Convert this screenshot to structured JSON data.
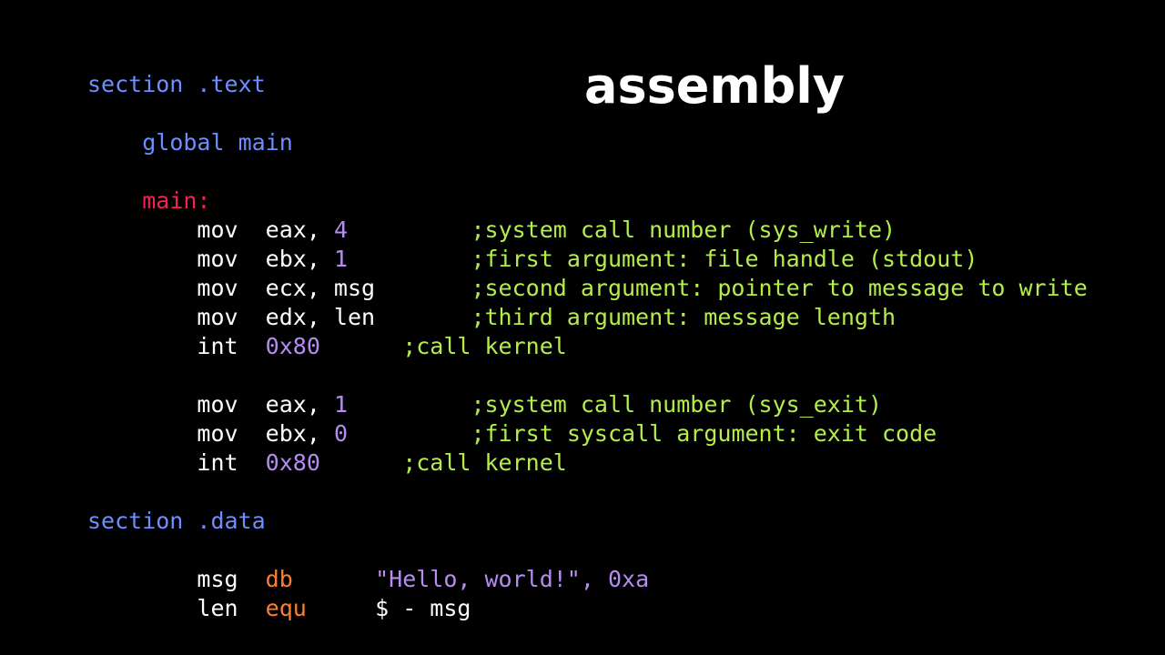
{
  "theme": {
    "background": "#000000",
    "title_color": "#ffffff",
    "directive_color": "#6e8eff",
    "label_color": "#f4224d",
    "plain_color": "#ffffff",
    "number_color": "#b68cf0",
    "string_color": "#b68cf0",
    "comment_color": "#b3ee4a",
    "pseudo_op_color": "#fd7f2e"
  },
  "title": "assembly",
  "code": {
    "language": "assembly",
    "lines": [
      {
        "id": "line-section-text",
        "tokens": [
          {
            "kind": "directive",
            "text": "section .text"
          }
        ]
      },
      {
        "id": "line-blank-1",
        "tokens": []
      },
      {
        "id": "line-global-main",
        "tokens": [
          {
            "kind": "plain",
            "text": "    "
          },
          {
            "kind": "directive",
            "text": "global main"
          }
        ]
      },
      {
        "id": "line-blank-2",
        "tokens": []
      },
      {
        "id": "line-label-main",
        "tokens": [
          {
            "kind": "plain",
            "text": "    "
          },
          {
            "kind": "label",
            "text": "main:"
          }
        ]
      },
      {
        "id": "line-mov-eax-4",
        "tokens": [
          {
            "kind": "plain",
            "text": "        mov  eax, "
          },
          {
            "kind": "num",
            "text": "4"
          },
          {
            "kind": "plain",
            "text": "         "
          },
          {
            "kind": "comment",
            "text": ";system call number (sys_write)"
          }
        ]
      },
      {
        "id": "line-mov-ebx-1",
        "tokens": [
          {
            "kind": "plain",
            "text": "        mov  ebx, "
          },
          {
            "kind": "num",
            "text": "1"
          },
          {
            "kind": "plain",
            "text": "         "
          },
          {
            "kind": "comment",
            "text": ";first argument: file handle (stdout)"
          }
        ]
      },
      {
        "id": "line-mov-ecx-msg",
        "tokens": [
          {
            "kind": "plain",
            "text": "        mov  ecx, msg       "
          },
          {
            "kind": "comment",
            "text": ";second argument: pointer to message to write"
          }
        ]
      },
      {
        "id": "line-mov-edx-len",
        "tokens": [
          {
            "kind": "plain",
            "text": "        mov  edx, len       "
          },
          {
            "kind": "comment",
            "text": ";third argument: message length"
          }
        ]
      },
      {
        "id": "line-int-80-a",
        "tokens": [
          {
            "kind": "plain",
            "text": "        int  "
          },
          {
            "kind": "num",
            "text": "0x80"
          },
          {
            "kind": "plain",
            "text": "      "
          },
          {
            "kind": "comment",
            "text": ";call kernel"
          }
        ]
      },
      {
        "id": "line-blank-3",
        "tokens": []
      },
      {
        "id": "line-mov-eax-1",
        "tokens": [
          {
            "kind": "plain",
            "text": "        mov  eax, "
          },
          {
            "kind": "num",
            "text": "1"
          },
          {
            "kind": "plain",
            "text": "         "
          },
          {
            "kind": "comment",
            "text": ";system call number (sys_exit)"
          }
        ]
      },
      {
        "id": "line-mov-ebx-0",
        "tokens": [
          {
            "kind": "plain",
            "text": "        mov  ebx, "
          },
          {
            "kind": "num",
            "text": "0"
          },
          {
            "kind": "plain",
            "text": "         "
          },
          {
            "kind": "comment",
            "text": ";first syscall argument: exit code"
          }
        ]
      },
      {
        "id": "line-int-80-b",
        "tokens": [
          {
            "kind": "plain",
            "text": "        int  "
          },
          {
            "kind": "num",
            "text": "0x80"
          },
          {
            "kind": "plain",
            "text": "      "
          },
          {
            "kind": "comment",
            "text": ";call kernel"
          }
        ]
      },
      {
        "id": "line-blank-4",
        "tokens": []
      },
      {
        "id": "line-section-data",
        "tokens": [
          {
            "kind": "directive",
            "text": "section .data"
          }
        ]
      },
      {
        "id": "line-blank-5",
        "tokens": []
      },
      {
        "id": "line-msg-db",
        "tokens": [
          {
            "kind": "plain",
            "text": "        msg  "
          },
          {
            "kind": "pseudo",
            "text": "db"
          },
          {
            "kind": "plain",
            "text": "      "
          },
          {
            "kind": "str",
            "text": "\"Hello, world!\", 0xa"
          }
        ]
      },
      {
        "id": "line-len-equ",
        "tokens": [
          {
            "kind": "plain",
            "text": "        len  "
          },
          {
            "kind": "pseudo",
            "text": "equ"
          },
          {
            "kind": "plain",
            "text": "     "
          },
          {
            "kind": "plain",
            "text": "$ - msg"
          }
        ]
      }
    ]
  }
}
